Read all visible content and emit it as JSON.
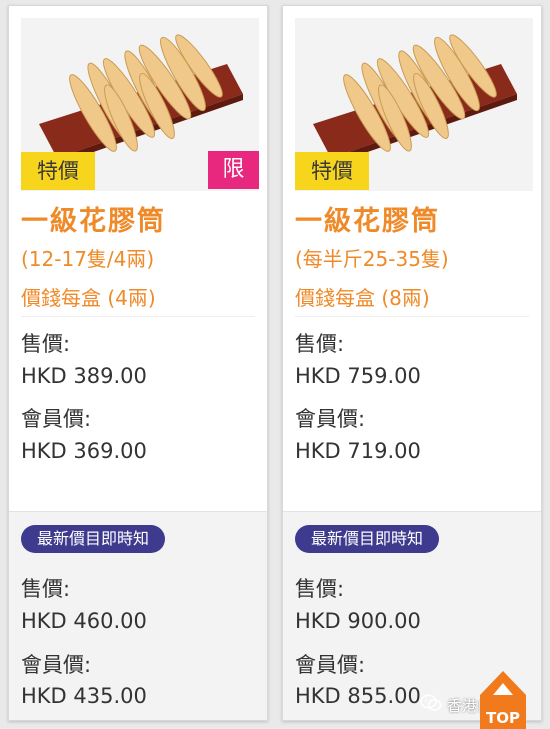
{
  "products": [
    {
      "tag_special": "特價",
      "tag_limited": "限",
      "name": "一級花膠筒",
      "spec": "(12-17隻/4兩)",
      "box_price": "價錢每盒 (4兩)",
      "selling_price_label": "售價:",
      "selling_price": "HKD 389.00",
      "member_price_label": "會員價:",
      "member_price": "HKD 369.00",
      "latest_price_badge": "最新價目即時知",
      "latest_selling_label": "售價:",
      "latest_selling_price": "HKD 460.00",
      "latest_member_label": "會員價:",
      "latest_member_price": "HKD 435.00"
    },
    {
      "tag_special": "特價",
      "name": "一級花膠筒",
      "spec": "(每半斤25-35隻)",
      "box_price": "價錢每盒 (8兩)",
      "selling_price_label": "售價:",
      "selling_price": "HKD 759.00",
      "member_price_label": "會員價:",
      "member_price": "HKD 719.00",
      "latest_price_badge": "最新價目即時知",
      "latest_selling_label": "售價:",
      "latest_selling_price": "HKD 900.00",
      "latest_member_label": "會員價:",
      "latest_member_price": "HKD 855.00"
    }
  ],
  "watermark": {
    "text": "香港自由行",
    "icon": "wechat-icon"
  },
  "top_button": {
    "label": "TOP",
    "icon": "arrow-up-icon"
  },
  "colors": {
    "accent_orange": "#ef8a29",
    "tag_special_yellow": "#f7d51d",
    "tag_limited_pink": "#e8277f",
    "badge_purple": "#3e3a8e",
    "top_button_orange": "#f07a1c"
  }
}
